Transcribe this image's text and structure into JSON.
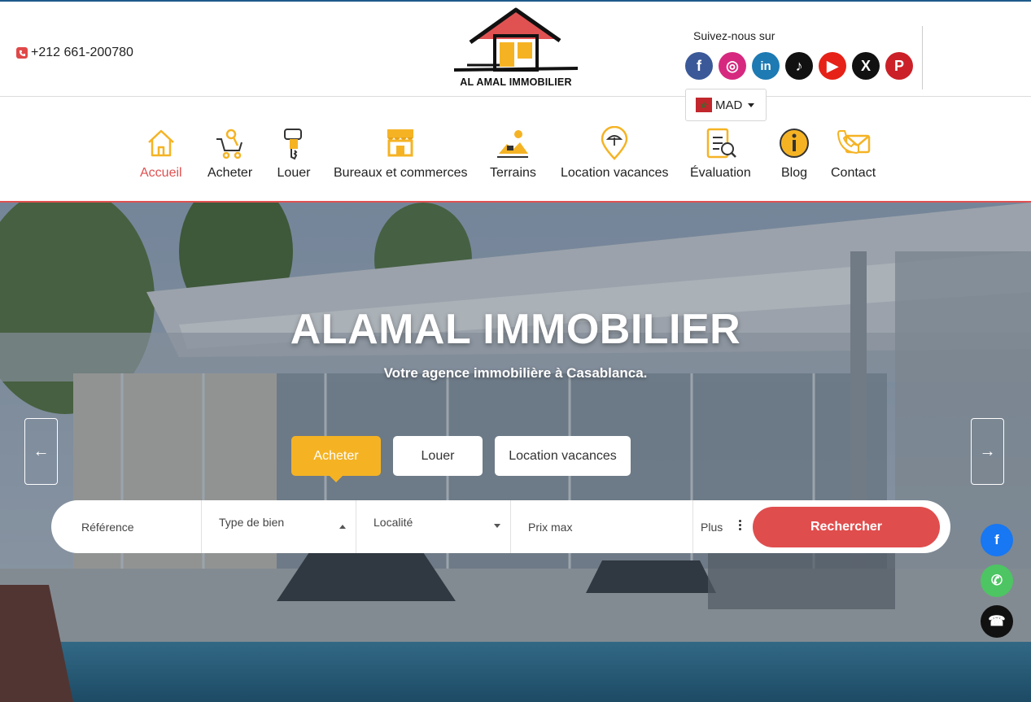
{
  "header": {
    "phone": "+212 661-200780",
    "logo_text": "AL AMAL IMMOBILIER",
    "follow_label": "Suivez-nous sur",
    "socials": [
      {
        "name": "facebook",
        "icon": "facebook-icon",
        "glyph": "f",
        "color": "#3b5998"
      },
      {
        "name": "instagram",
        "icon": "instagram-icon",
        "glyph": "◎",
        "color": "#d6287f"
      },
      {
        "name": "linkedin",
        "icon": "linkedin-icon",
        "glyph": "in",
        "color": "#1d7ab3"
      },
      {
        "name": "tiktok",
        "icon": "tiktok-icon",
        "glyph": "♪",
        "color": "#111111"
      },
      {
        "name": "youtube",
        "icon": "youtube-icon",
        "glyph": "▶",
        "color": "#e62117"
      },
      {
        "name": "x",
        "icon": "x-icon",
        "glyph": "X",
        "color": "#111111"
      },
      {
        "name": "pinterest",
        "icon": "pinterest-icon",
        "glyph": "P",
        "color": "#cb2027"
      }
    ],
    "currency": "MAD"
  },
  "nav": {
    "items": [
      {
        "label": "Accueil",
        "icon": "home-icon",
        "active": true
      },
      {
        "label": "Acheter",
        "icon": "cart-key-icon"
      },
      {
        "label": "Louer",
        "icon": "key-icon"
      },
      {
        "label": "Bureaux et commerces",
        "icon": "shop-icon"
      },
      {
        "label": "Terrains",
        "icon": "land-icon"
      },
      {
        "label": "Location vacances",
        "icon": "beach-pin-icon"
      },
      {
        "label": "Évaluation",
        "icon": "checklist-icon"
      },
      {
        "label": "Blog",
        "icon": "info-icon"
      },
      {
        "label": "Contact",
        "icon": "mail-phone-icon"
      }
    ]
  },
  "hero": {
    "title": "ALAMAL IMMOBILIER",
    "subtitle": "Votre agence immobilière à Casablanca.",
    "prev_arrow": "←",
    "next_arrow": "→"
  },
  "tabs": [
    {
      "label": "Acheter",
      "active": true
    },
    {
      "label": "Louer"
    },
    {
      "label": "Location vacances"
    }
  ],
  "search": {
    "reference_placeholder": "Référence",
    "type_label": "Type de bien",
    "locality_label": "Localité",
    "price_placeholder": "Prix max",
    "more_label": "Plus",
    "submit_label": "Rechercher"
  },
  "floating": [
    {
      "name": "facebook",
      "icon": "facebook-icon",
      "glyph": "f",
      "color": "#1877f2"
    },
    {
      "name": "whatsapp",
      "icon": "whatsapp-icon",
      "glyph": "✆",
      "color": "#4cc562"
    },
    {
      "name": "phone",
      "icon": "phone-icon",
      "glyph": "☎",
      "color": "#111111"
    }
  ],
  "colors": {
    "accent": "#e04d4d",
    "yellow": "#f5b324",
    "nav_icon": "#f5b324"
  }
}
